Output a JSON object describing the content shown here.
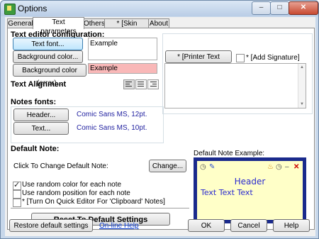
{
  "window": {
    "title": "Options",
    "min": "–",
    "max": "□",
    "close": "✕"
  },
  "tabs": [
    "General",
    "Text parameters",
    "Others",
    "* [Skin Browser]",
    "About"
  ],
  "text_editor": {
    "section_title": "Text editor configuration:",
    "text_font_button": "Text font...",
    "background_color_button": "Background color...",
    "background_color_error_button": "Background color (error)...",
    "example_text": "Example",
    "example_error_text": "Example",
    "error_color": "#f9b8b8",
    "text_alignment_label": "Text Alignment"
  },
  "printer": {
    "printer_font_button": "* [Printer Text Font...]",
    "add_signature_label": "* [Add Signature]"
  },
  "notes_fonts": {
    "section_title": "Notes fonts:",
    "header_button": "Header...",
    "header_value": "Comic Sans MS,  12pt.",
    "text_button": "Text...",
    "text_value": "Comic Sans MS,  10pt."
  },
  "default_note": {
    "section_title": "Default Note:",
    "click_label": "Click To Change Default Note:",
    "change_button": "Change...",
    "random_color_label": "Use random color for each note",
    "random_position_label": "Use random position for each note",
    "quick_editor_label": "* [Turn On Quick Editor For 'Clipboard' Notes]",
    "example_label": "Default Note Example:",
    "note_header": "Header",
    "note_text": "Text Text Text"
  },
  "reset_button": "Reset To Default Settings",
  "footer": {
    "restore_button": "Restore default settings",
    "help_link": "On-line Help",
    "ok_button": "OK",
    "cancel_button": "Cancel",
    "help_button": "Help"
  }
}
